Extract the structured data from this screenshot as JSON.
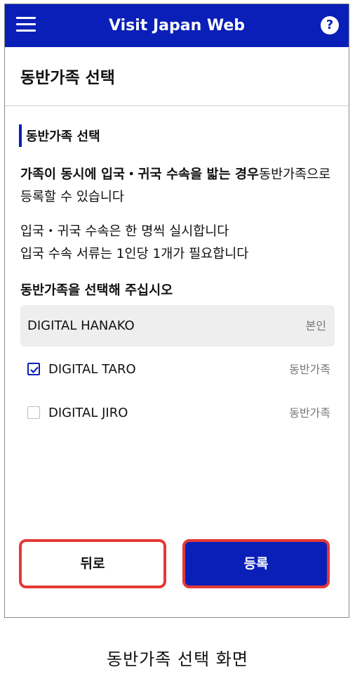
{
  "appbar": {
    "title": "Visit Japan Web",
    "help_glyph": "?"
  },
  "page": {
    "title": "동반가족 선택",
    "section_label": "동반가족 선택",
    "intro_bold": "가족이 동시에 입국・귀국 수속을 밟는 경우",
    "intro_rest": "동반가족으로 등록할 수 있습니다",
    "note_line1": "입국・귀국 수속은 한 명씩 실시합니다",
    "note_line2": "입국 수속 서류는 1인당 1개가 필요합니다",
    "prompt": "동반가족을 선택해 주십시오"
  },
  "self": {
    "name": "DIGITAL HANAKO",
    "tag": "본인"
  },
  "members": [
    {
      "name": "DIGITAL TARO",
      "tag": "동반가족",
      "checked": true
    },
    {
      "name": "DIGITAL JIRO",
      "tag": "동반가족",
      "checked": false
    }
  ],
  "buttons": {
    "back": "뒤로",
    "register": "등록"
  },
  "caption": "동반가족 선택 화면",
  "colors": {
    "brand": "#0a1fb8",
    "highlight_border": "#e53935"
  }
}
